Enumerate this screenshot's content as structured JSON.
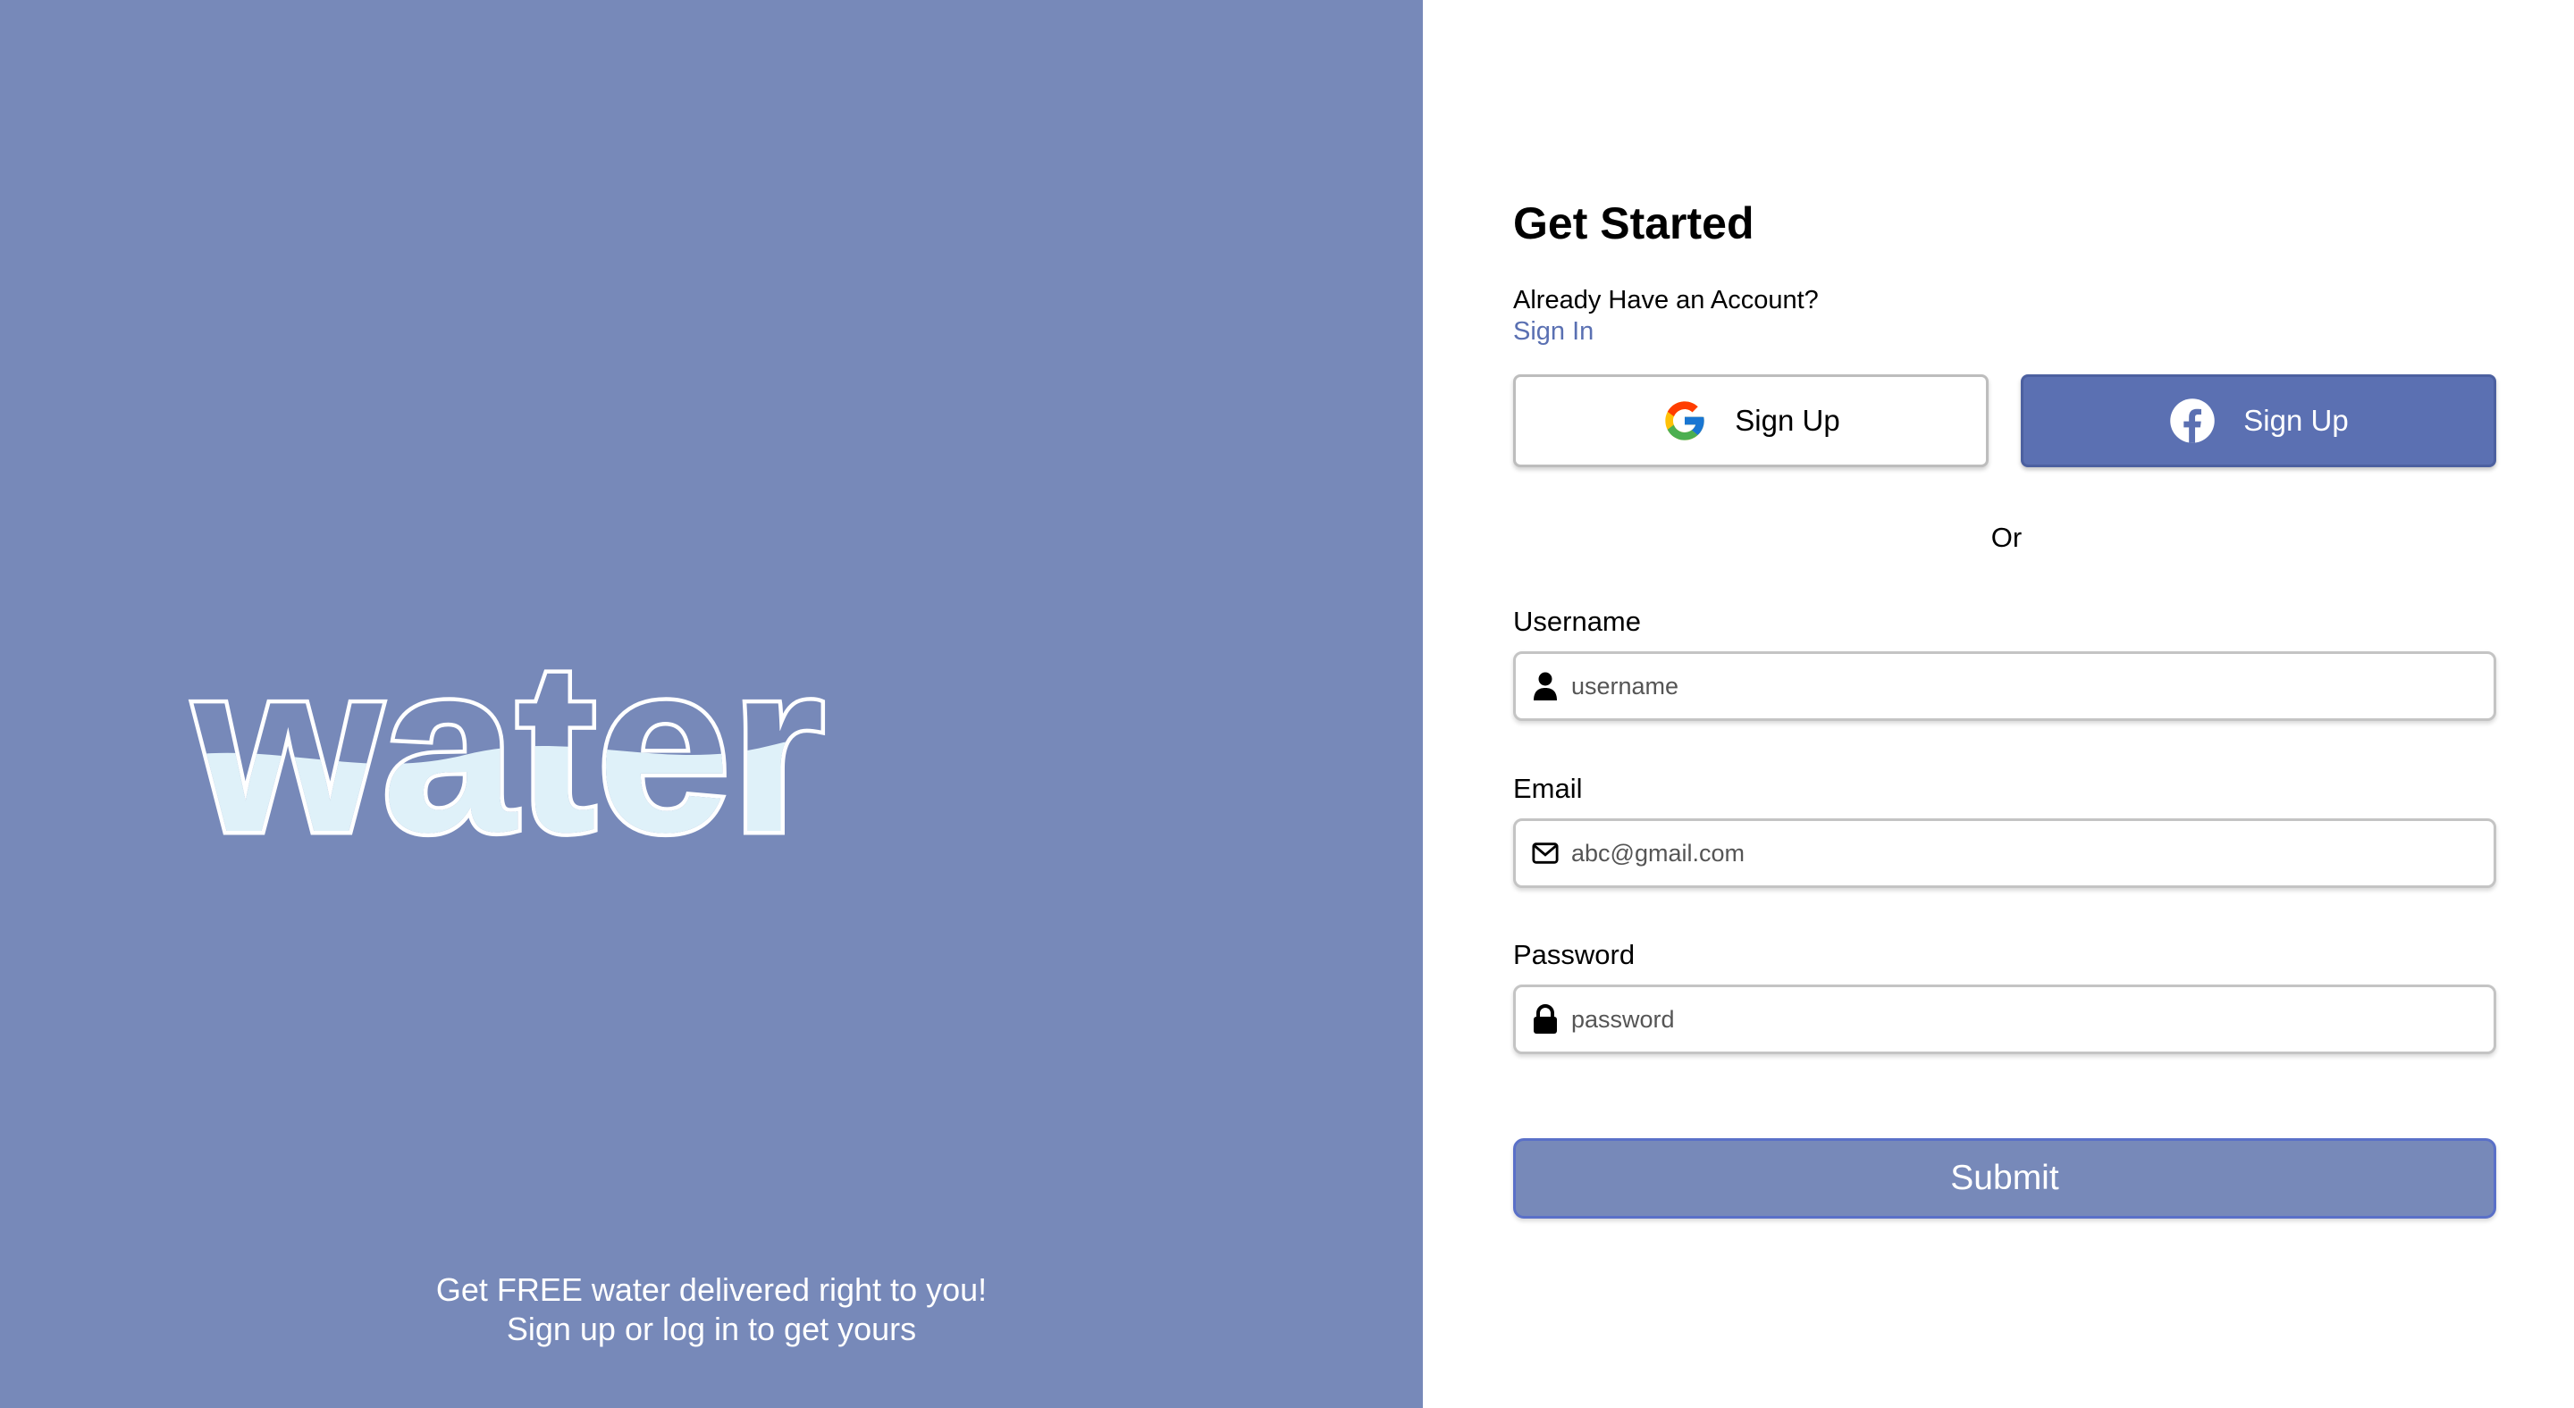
{
  "brand": {
    "logo_text": "water",
    "tagline_line1": "Get FREE water delivered right to you!",
    "tagline_line2": "Sign up or log in to get yours",
    "panel_color": "#7789b9",
    "water_fill_color": "#dff1f9"
  },
  "form": {
    "title": "Get Started",
    "already_text": "Already Have an Account?",
    "signin_label": "Sign In",
    "google_button": {
      "label": "Sign Up",
      "icon": "google-icon"
    },
    "facebook_button": {
      "label": "Sign Up",
      "icon": "facebook-icon"
    },
    "divider_text": "Or",
    "fields": {
      "username": {
        "label": "Username",
        "placeholder": "username",
        "value": "",
        "icon": "user-icon"
      },
      "email": {
        "label": "Email",
        "placeholder": "abc@gmail.com",
        "value": "",
        "icon": "envelope-icon"
      },
      "password": {
        "label": "Password",
        "placeholder": "password",
        "value": "",
        "icon": "lock-icon"
      }
    },
    "submit_label": "Submit",
    "accent_color": "#5b70b2"
  }
}
